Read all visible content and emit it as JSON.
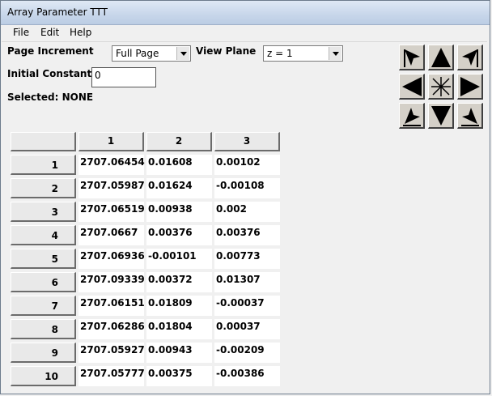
{
  "window": {
    "title": "Array Parameter TTT"
  },
  "menu": [
    "File",
    "Edit",
    "Help"
  ],
  "controls": {
    "page_increment_label": "Page Increment",
    "page_increment_value": "Full Page",
    "view_plane_label": "View Plane",
    "view_plane_value": "z = 1",
    "initial_constant_label": "Initial Constant",
    "initial_constant_value": "0",
    "selected_text": "Selected: NONE"
  },
  "table": {
    "col_headers": [
      "1",
      "2",
      "3"
    ],
    "rows": [
      {
        "label": "1",
        "cells": [
          "2707.06454",
          "0.01608",
          "0.00102"
        ]
      },
      {
        "label": "2",
        "cells": [
          "2707.05987",
          "0.01624",
          "-0.00108"
        ]
      },
      {
        "label": "3",
        "cells": [
          "2707.06519",
          "0.00938",
          "0.002"
        ]
      },
      {
        "label": "4",
        "cells": [
          "2707.0667",
          "0.00376",
          "0.00376"
        ]
      },
      {
        "label": "5",
        "cells": [
          "2707.06936",
          "-0.00101",
          "0.00773"
        ]
      },
      {
        "label": "6",
        "cells": [
          "2707.09339",
          "0.00372",
          "0.01307"
        ]
      },
      {
        "label": "7",
        "cells": [
          "2707.06151",
          "0.01809",
          "-0.00037"
        ]
      },
      {
        "label": "8",
        "cells": [
          "2707.06286",
          "0.01804",
          "0.00037"
        ]
      },
      {
        "label": "9",
        "cells": [
          "2707.05927",
          "0.00943",
          "-0.00209"
        ]
      },
      {
        "label": "10",
        "cells": [
          "2707.05777",
          "0.00375",
          "-0.00386"
        ]
      }
    ]
  },
  "nav_icons": [
    "up-left-arrow-icon",
    "up-arrow-icon",
    "up-right-arrow-icon",
    "left-arrow-icon",
    "center-star-icon",
    "right-arrow-icon",
    "down-left-arrow-icon",
    "down-arrow-icon",
    "down-right-arrow-icon"
  ]
}
